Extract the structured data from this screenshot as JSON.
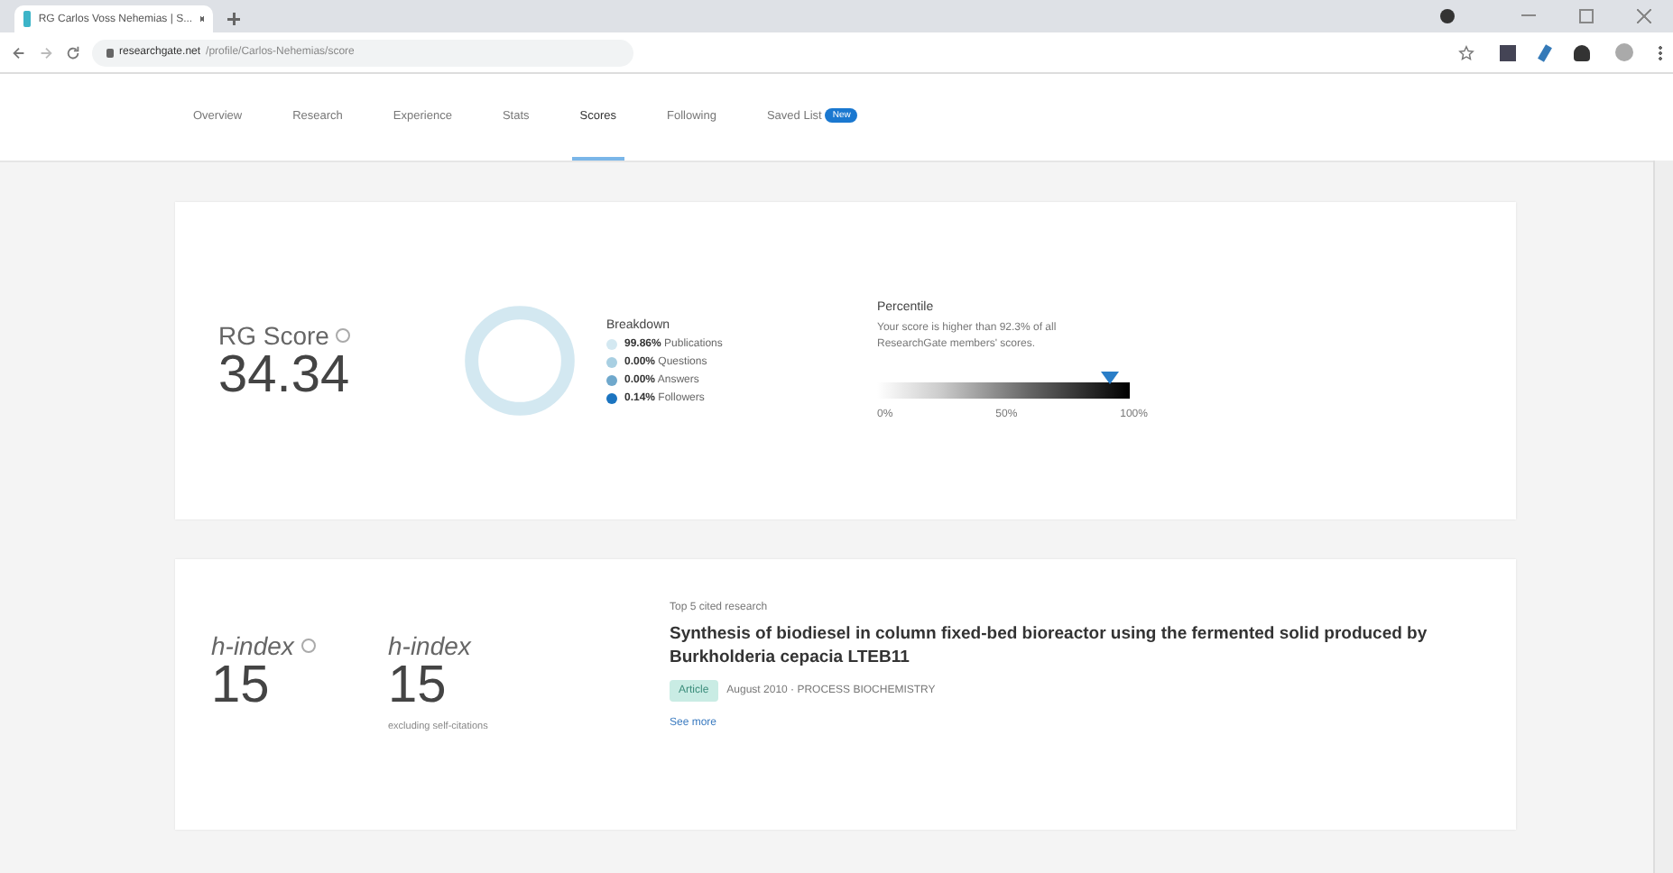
{
  "browser": {
    "tab_title": "RG Carlos Voss Nehemias | S...",
    "url_host": "researchgate.net",
    "url_path": "/profile/Carlos-Nehemias/score"
  },
  "tabs": [
    {
      "label": "Overview",
      "selected": false
    },
    {
      "label": "Research",
      "selected": false
    },
    {
      "label": "Experience",
      "selected": false
    },
    {
      "label": "Stats",
      "selected": false
    },
    {
      "label": "Scores",
      "selected": true
    },
    {
      "label": "Following",
      "selected": false
    },
    {
      "label": "Saved List",
      "selected": false,
      "badge": "New"
    }
  ],
  "rg_score": {
    "label": "RG Score",
    "value": "34.34",
    "breakdown_title": "Breakdown",
    "breakdown": [
      {
        "percent": "99.86%",
        "label": "Publications",
        "color": "#d3e8f1"
      },
      {
        "percent": "0.00%",
        "label": "Questions",
        "color": "#a8cfe2"
      },
      {
        "percent": "0.00%",
        "label": "Answers",
        "color": "#6fa8cc"
      },
      {
        "percent": "0.14%",
        "label": "Followers",
        "color": "#1b74c0"
      }
    ],
    "percentile_title": "Percentile",
    "percentile_text": "Your score is higher than 92.3% of all ResearchGate members' scores.",
    "percentile": {
      "level": 0.923
    },
    "scale": [
      "0%",
      "50%",
      "100%"
    ]
  },
  "h_index": {
    "label": "h-index",
    "value": "15",
    "alt_label": "h-index",
    "alt_value": "15",
    "alt_note": "excluding self-citations",
    "top_title": "Top 5 cited research",
    "paper_title": "Synthesis of biodiesel in column fixed-bed bioreactor using the fermented solid produced by Burkholderia cepacia LTEB11",
    "paper_type": "Article",
    "paper_meta": "August 2010 · PROCESS BIOCHEMISTRY",
    "see_more": "See more"
  }
}
